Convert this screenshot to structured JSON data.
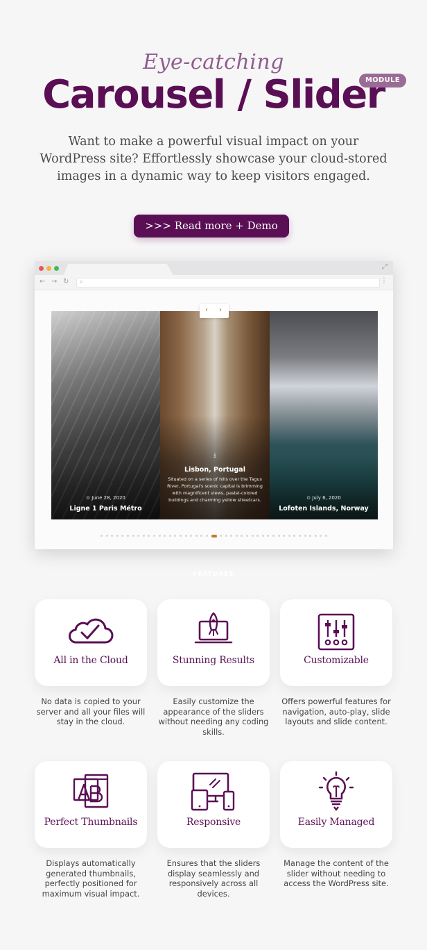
{
  "hero": {
    "eyebrow": "Eye-catching",
    "title": "Carousel / Slider",
    "badge": "MODULE",
    "intro": "Want to make a powerful visual impact on your WordPress site? Effortlessly showcase your cloud-stored images in a dynamic way to keep visitors engaged.",
    "cta_label": ">>> Read more + Demo"
  },
  "browser": {
    "dot_colors": [
      "#e85a4f",
      "#f2b43a",
      "#3fbe4b"
    ],
    "slides": [
      {
        "date": "⊙ June 28, 2020",
        "title": "Ligne 1 Paris Métro"
      },
      {
        "download_icon": "download-icon",
        "title": "Lisbon, Portugal",
        "description": "Situated on a series of hills over the Tagus River, Portugal's scenic capital is brimming with magnificent views, pastel-colored buildings and charming yellow streetcars."
      },
      {
        "date": "⊙ July 6, 2020",
        "title": "Lofoten Islands, Norway"
      }
    ],
    "prev_glyph": "‹",
    "next_glyph": "›",
    "pager_count": 43,
    "pager_active_index": 21
  },
  "features_label": "FEATURES",
  "features": [
    {
      "icon": "cloud-check-icon",
      "title": "All in the Cloud",
      "description": "No data is copied to your server and all your files will stay in the cloud."
    },
    {
      "icon": "laptop-rocket-icon",
      "title": "Stunning Results",
      "description": "Easily customize the appearance of the sliders without needing any coding skills."
    },
    {
      "icon": "sliders-panel-icon",
      "title": "Customizable",
      "description": "Offers powerful features for navigation, auto-play, slide layouts and slide content."
    },
    {
      "icon": "thumbnail-ab-icon",
      "title": "Perfect Thumbnails",
      "description": "Displays automatically generated thumbnails, perfectly positioned for maximum visual impact."
    },
    {
      "icon": "devices-icon",
      "title": "Responsive",
      "description": "Ensures that the sliders display seamlessly and responsively across all devices."
    },
    {
      "icon": "lightbulb-icon",
      "title": "Easily Managed",
      "description": "Manage the content of the slider without needing to access the WordPress site."
    }
  ],
  "colors": {
    "brand": "#5a0f55",
    "badge": "#9a6c95",
    "accent": "#c07a2a"
  }
}
